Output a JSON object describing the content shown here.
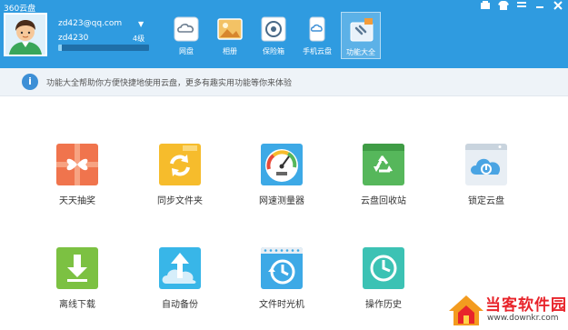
{
  "app": {
    "title": "360云盘"
  },
  "window_controls": {
    "skin_icon": "skin-icon",
    "shirt_icon": "shirt-icon",
    "menu_icon": "menu-icon",
    "minimize_icon": "minimize-icon",
    "close_icon": "close-icon"
  },
  "account": {
    "email": "zd423@qq.com",
    "user_id": "zd4230",
    "level": "4级",
    "storage_used_fraction": 0.04,
    "colors": {
      "bar_bg": "#1f6fa8",
      "bar_fill": "#8fd2f6"
    }
  },
  "nav": {
    "items": [
      {
        "label": "网盘",
        "icon": "cloud-disk-icon"
      },
      {
        "label": "相册",
        "icon": "photo-album-icon"
      },
      {
        "label": "保险箱",
        "icon": "safe-box-icon"
      },
      {
        "label": "手机云盘",
        "icon": "mobile-cloud-icon"
      },
      {
        "label": "功能大全",
        "icon": "feature-toolbox-icon",
        "active": true
      }
    ]
  },
  "info_bar": {
    "text": "功能大全帮助你方便快捷地使用云盘，更多有趣实用功能等你来体验"
  },
  "features": {
    "row1": [
      {
        "label": "天天抽奖",
        "icon": "daily-lottery-icon",
        "color": "#f0744d"
      },
      {
        "label": "同步文件夹",
        "icon": "sync-folder-icon",
        "color": "#f6bc2c"
      },
      {
        "label": "网速测量器",
        "icon": "speed-meter-icon",
        "color": "#3da9e6"
      },
      {
        "label": "云盘回收站",
        "icon": "recycle-bin-icon",
        "color": "#56b75b"
      },
      {
        "label": "锁定云盘",
        "icon": "lock-cloud-icon",
        "color": "#4aa4e3"
      }
    ],
    "row2": [
      {
        "label": "离线下载",
        "icon": "offline-download-icon",
        "color": "#7cc142"
      },
      {
        "label": "自动备份",
        "icon": "auto-backup-icon",
        "color": "#38b6e8"
      },
      {
        "label": "文件时光机",
        "icon": "file-time-machine-icon",
        "color": "#3da9e6"
      },
      {
        "label": "操作历史",
        "icon": "operation-history-icon",
        "color": "#3cc2b4"
      }
    ]
  },
  "watermark": {
    "text": "当客软件园",
    "url": "www.downkr.com"
  },
  "colors": {
    "header": "#2f9be0",
    "info_bar": "#eef3f8"
  }
}
